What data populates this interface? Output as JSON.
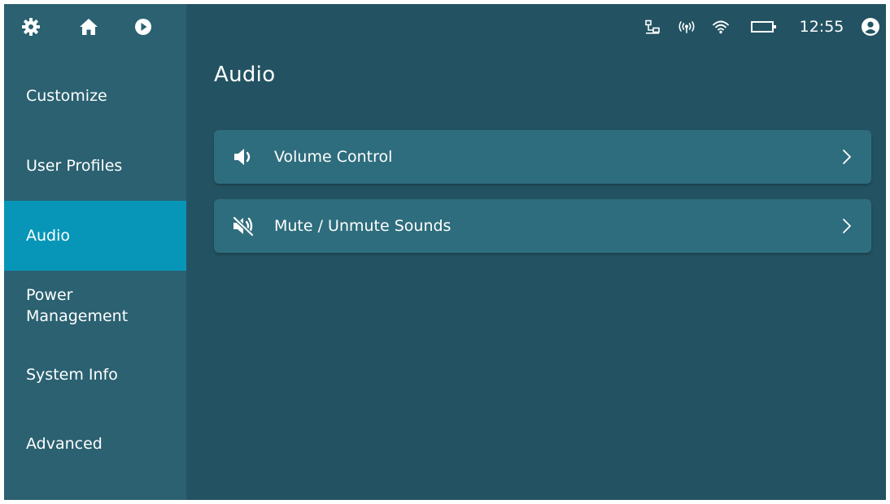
{
  "topbar": {
    "left_icons": [
      "gear-icon",
      "home-icon",
      "play-circle-icon"
    ],
    "status_icons": [
      "network-icon",
      "antenna-icon",
      "wifi-icon",
      "battery-icon",
      "user-icon"
    ],
    "clock": "12:55"
  },
  "sidebar": {
    "items": [
      {
        "label": "Customize",
        "active": false
      },
      {
        "label": "User Profiles",
        "active": false
      },
      {
        "label": "Audio",
        "active": true
      },
      {
        "label": "Power Management",
        "active": false
      },
      {
        "label": "System Info",
        "active": false
      },
      {
        "label": "Advanced",
        "active": false
      }
    ]
  },
  "main": {
    "title": "Audio",
    "cards": [
      {
        "label": "Volume Control",
        "icon": "speaker-icon"
      },
      {
        "label": "Mute / Unmute Sounds",
        "icon": "mute-icon"
      }
    ]
  },
  "colors": {
    "background": "#235362",
    "sidebar": "#2b6171",
    "active": "#0796b7",
    "card": "#2e6d7d",
    "text": "#ffffff"
  }
}
